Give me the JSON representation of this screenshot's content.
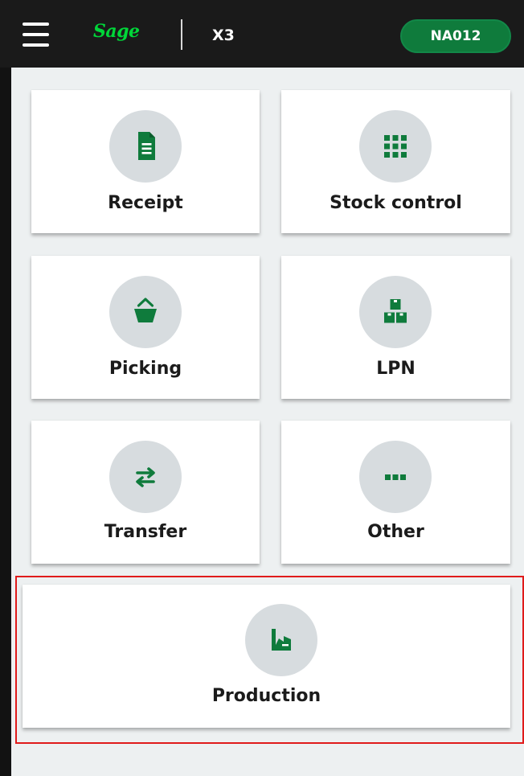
{
  "header": {
    "menu_icon": "hamburger-menu-icon",
    "brand": "Sage",
    "product": "X3",
    "site_code": "NA012",
    "brand_color": "#00d639",
    "badge_color": "#0f7b3c"
  },
  "tiles": [
    {
      "label": "Receipt",
      "icon": "document-icon"
    },
    {
      "label": "Stock control",
      "icon": "grid-icon"
    },
    {
      "label": "Picking",
      "icon": "basket-icon"
    },
    {
      "label": "LPN",
      "icon": "boxes-icon"
    },
    {
      "label": "Transfer",
      "icon": "transfer-arrows-icon"
    },
    {
      "label": "Other",
      "icon": "more-dots-icon"
    },
    {
      "label": "Production",
      "icon": "factory-icon"
    }
  ],
  "styles": {
    "icon_color": "#0f7b3c",
    "icon_circle": "#d7dcdf",
    "highlight_color": "#e01b1b",
    "highlighted_tile": "Production"
  }
}
